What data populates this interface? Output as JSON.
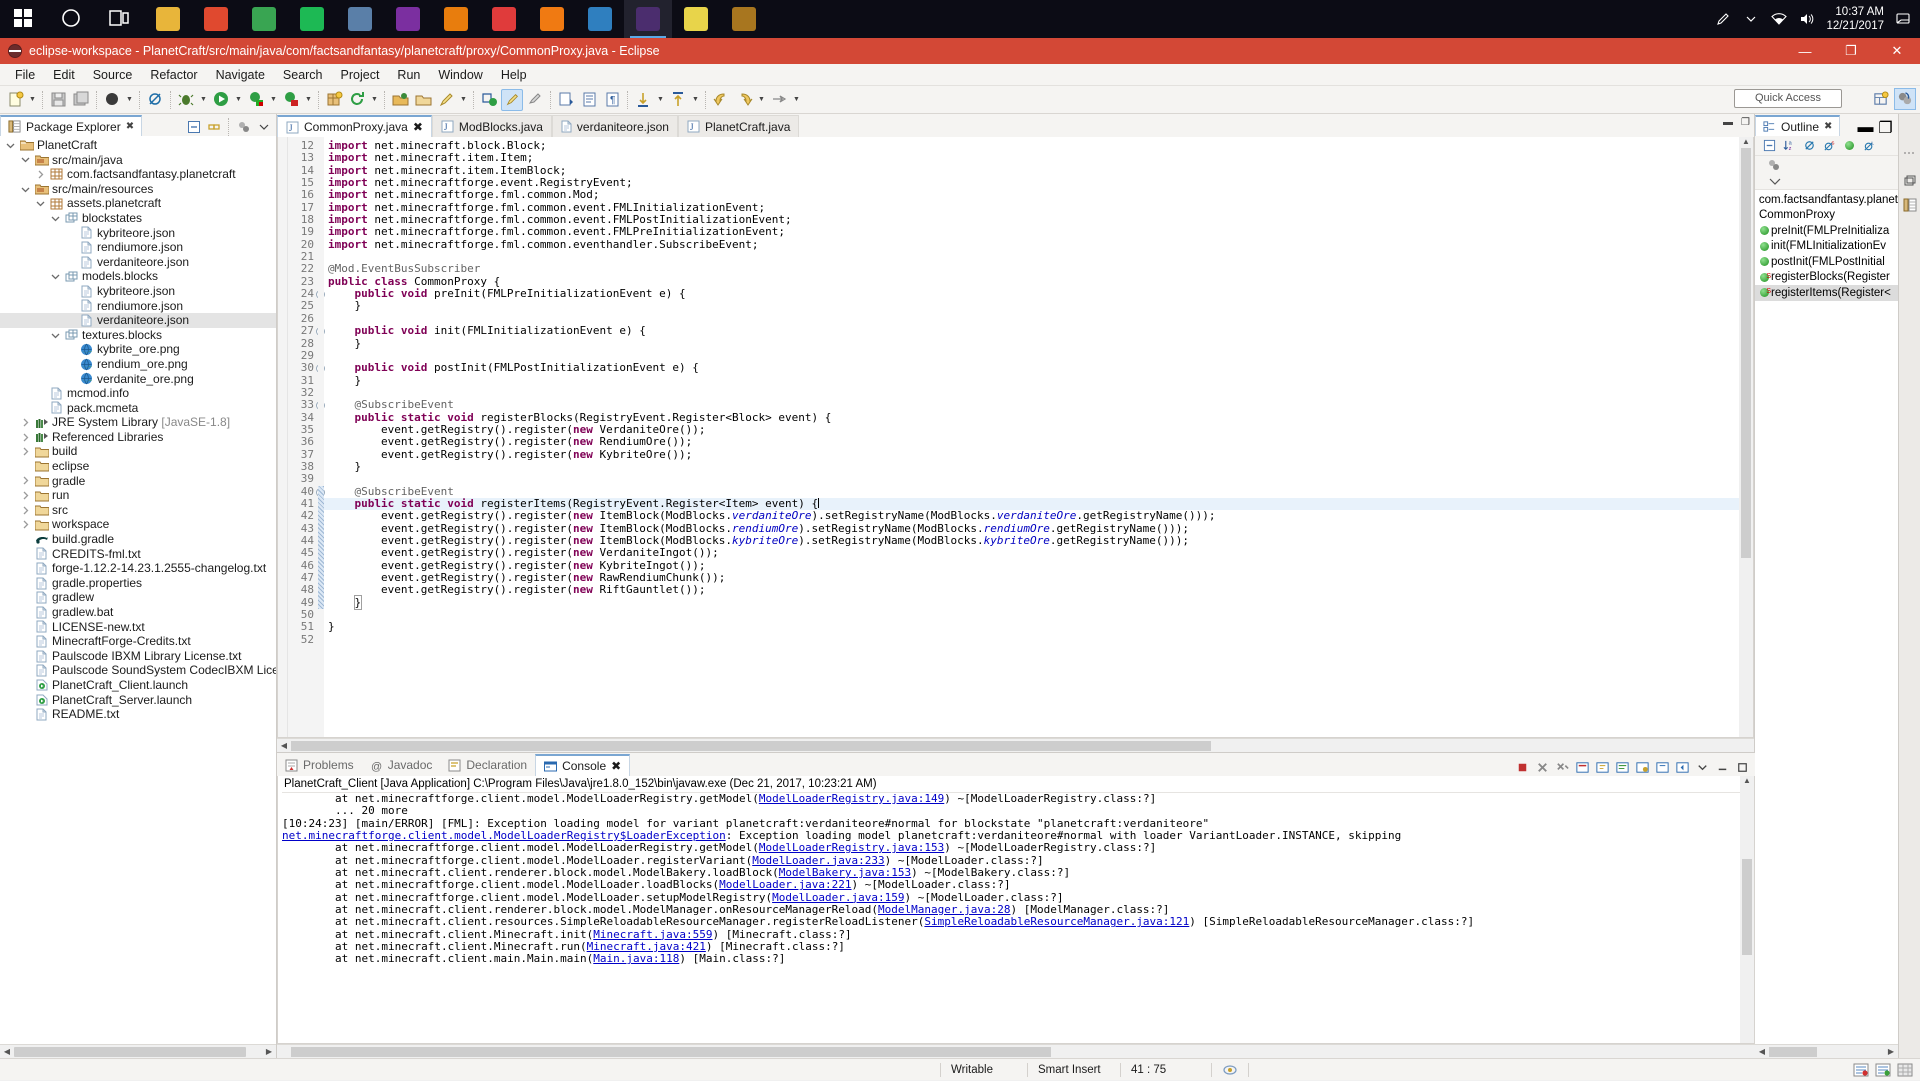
{
  "taskbar": {
    "apps": [
      {
        "name": "start-windows",
        "color": "#2a8fd6"
      },
      {
        "name": "cortana-search",
        "color": "#1b1b26"
      },
      {
        "name": "task-view",
        "color": "#1b1b26"
      },
      {
        "name": "video-editor",
        "color": "#e8b53a"
      },
      {
        "name": "paint-app",
        "color": "#e0492f"
      },
      {
        "name": "chrome-browser",
        "color": "#39a552"
      },
      {
        "name": "spotify",
        "color": "#1db954"
      },
      {
        "name": "calculator",
        "color": "#5a7fa8"
      },
      {
        "name": "onenote",
        "color": "#7b2fa0"
      },
      {
        "name": "blender",
        "color": "#e87d0d"
      },
      {
        "name": "recording-app",
        "color": "#e03b3b"
      },
      {
        "name": "vlc-player",
        "color": "#f07a12"
      },
      {
        "name": "globe-browser",
        "color": "#2f7fbf"
      },
      {
        "name": "eclipse-ide",
        "color": "#4b2d6e"
      },
      {
        "name": "notepad",
        "color": "#e8d44a"
      },
      {
        "name": "package-app",
        "color": "#a8761f"
      }
    ],
    "active_index": 13,
    "tray": {
      "pen_icon": "pen-icon",
      "chevron_icon": "show-hidden-icons-icon",
      "network_icon": "network-icon",
      "volume_icon": "volume-icon",
      "time": "10:37 AM",
      "date": "12/21/2017",
      "notifications_icon": "notifications-icon"
    }
  },
  "window": {
    "title": "eclipse-workspace - PlanetCraft/src/main/java/com/factsandfantasy/planetcraft/proxy/CommonProxy.java - Eclipse",
    "minimize": "—",
    "maximize": "❐",
    "close": "✕"
  },
  "menubar": {
    "items": [
      "File",
      "Edit",
      "Source",
      "Refactor",
      "Navigate",
      "Search",
      "Project",
      "Run",
      "Window",
      "Help"
    ]
  },
  "toolbar": {
    "quick_access_placeholder": "Quick Access",
    "buttons": [
      "new-wizard",
      "save",
      "save-all",
      "debug-skip-breakpoints",
      "toggle-breakpoint",
      "debug",
      "run",
      "run-external-tools",
      "coverage",
      "new-java-package",
      "refresh",
      "open-type",
      "open-task",
      "search",
      "next-annotation",
      "previous-annotation",
      "last-edit-location",
      "back",
      "forward",
      "pin-editor"
    ]
  },
  "explorer": {
    "tab_label": "Package Explorer",
    "toolbar_icons": [
      "collapse-all-icon",
      "link-with-editor-icon",
      "view-menu-icon",
      "view-chevron-icon"
    ],
    "tree": [
      {
        "depth": 0,
        "twist": "down",
        "icon": "project",
        "label": "PlanetCraft"
      },
      {
        "depth": 1,
        "twist": "down",
        "icon": "source-folder",
        "label": "src/main/java"
      },
      {
        "depth": 2,
        "twist": "right",
        "icon": "package",
        "label": "com.factsandfantasy.planetcraft"
      },
      {
        "depth": 1,
        "twist": "down",
        "icon": "source-folder",
        "label": "src/main/resources"
      },
      {
        "depth": 2,
        "twist": "down",
        "icon": "package",
        "label": "assets.planetcraft"
      },
      {
        "depth": 3,
        "twist": "down",
        "icon": "subpackage",
        "label": "blockstates"
      },
      {
        "depth": 4,
        "twist": "none",
        "icon": "file",
        "label": "kybriteore.json"
      },
      {
        "depth": 4,
        "twist": "none",
        "icon": "file",
        "label": "rendiumore.json"
      },
      {
        "depth": 4,
        "twist": "none",
        "icon": "file",
        "label": "verdaniteore.json"
      },
      {
        "depth": 3,
        "twist": "down",
        "icon": "subpackage",
        "label": "models.blocks"
      },
      {
        "depth": 4,
        "twist": "none",
        "icon": "file",
        "label": "kybriteore.json"
      },
      {
        "depth": 4,
        "twist": "none",
        "icon": "file",
        "label": "rendiumore.json"
      },
      {
        "depth": 4,
        "twist": "none",
        "icon": "file",
        "label": "verdaniteore.json",
        "selected": true
      },
      {
        "depth": 3,
        "twist": "down",
        "icon": "subpackage",
        "label": "textures.blocks"
      },
      {
        "depth": 4,
        "twist": "none",
        "icon": "image",
        "label": "kybrite_ore.png"
      },
      {
        "depth": 4,
        "twist": "none",
        "icon": "image",
        "label": "rendium_ore.png"
      },
      {
        "depth": 4,
        "twist": "none",
        "icon": "image",
        "label": "verdanite_ore.png"
      },
      {
        "depth": 2,
        "twist": "none",
        "icon": "file",
        "label": "mcmod.info"
      },
      {
        "depth": 2,
        "twist": "none",
        "icon": "file",
        "label": "pack.mcmeta"
      },
      {
        "depth": 1,
        "twist": "right",
        "icon": "library",
        "label": "JRE System Library ",
        "dim": "[JavaSE-1.8]"
      },
      {
        "depth": 1,
        "twist": "right",
        "icon": "library",
        "label": "Referenced Libraries"
      },
      {
        "depth": 1,
        "twist": "right",
        "icon": "folder",
        "label": "build"
      },
      {
        "depth": 1,
        "twist": "none",
        "icon": "folder",
        "label": "eclipse"
      },
      {
        "depth": 1,
        "twist": "right",
        "icon": "folder",
        "label": "gradle"
      },
      {
        "depth": 1,
        "twist": "right",
        "icon": "folder",
        "label": "run"
      },
      {
        "depth": 1,
        "twist": "right",
        "icon": "folder",
        "label": "src"
      },
      {
        "depth": 1,
        "twist": "right",
        "icon": "folder",
        "label": "workspace"
      },
      {
        "depth": 1,
        "twist": "none",
        "icon": "gradle",
        "label": "build.gradle"
      },
      {
        "depth": 1,
        "twist": "none",
        "icon": "file",
        "label": "CREDITS-fml.txt"
      },
      {
        "depth": 1,
        "twist": "none",
        "icon": "file",
        "label": "forge-1.12.2-14.23.1.2555-changelog.txt"
      },
      {
        "depth": 1,
        "twist": "none",
        "icon": "file",
        "label": "gradle.properties"
      },
      {
        "depth": 1,
        "twist": "none",
        "icon": "file",
        "label": "gradlew"
      },
      {
        "depth": 1,
        "twist": "none",
        "icon": "file",
        "label": "gradlew.bat"
      },
      {
        "depth": 1,
        "twist": "none",
        "icon": "file",
        "label": "LICENSE-new.txt"
      },
      {
        "depth": 1,
        "twist": "none",
        "icon": "file",
        "label": "MinecraftForge-Credits.txt"
      },
      {
        "depth": 1,
        "twist": "none",
        "icon": "file",
        "label": "Paulscode IBXM Library License.txt"
      },
      {
        "depth": 1,
        "twist": "none",
        "icon": "file",
        "label": "Paulscode SoundSystem CodecIBXM License.txt"
      },
      {
        "depth": 1,
        "twist": "none",
        "icon": "launch",
        "label": "PlanetCraft_Client.launch"
      },
      {
        "depth": 1,
        "twist": "none",
        "icon": "launch",
        "label": "PlanetCraft_Server.launch"
      },
      {
        "depth": 1,
        "twist": "none",
        "icon": "file",
        "label": "README.txt"
      }
    ]
  },
  "editor": {
    "tabs": [
      {
        "label": "CommonProxy.java",
        "icon": "java-file-icon",
        "active": true,
        "closable": true
      },
      {
        "label": "ModBlocks.java",
        "icon": "java-file-icon",
        "active": false,
        "closable": false
      },
      {
        "label": "verdaniteore.json",
        "icon": "json-file-icon",
        "active": false,
        "closable": false
      },
      {
        "label": "PlanetCraft.java",
        "icon": "java-file-icon",
        "active": false,
        "closable": false
      }
    ],
    "minimize_label": "—",
    "maximize_label": "❐",
    "first_line_number": 12,
    "lines": [
      {
        "n": 12,
        "fold": false,
        "html": "<span class=\"kw\">import</span> net.minecraft.block.Block;"
      },
      {
        "n": 13,
        "fold": false,
        "html": "<span class=\"kw\">import</span> net.minecraft.item.Item;"
      },
      {
        "n": 14,
        "fold": false,
        "html": "<span class=\"kw\">import</span> net.minecraft.item.ItemBlock;"
      },
      {
        "n": 15,
        "fold": false,
        "html": "<span class=\"kw\">import</span> net.minecraftforge.event.RegistryEvent;"
      },
      {
        "n": 16,
        "fold": false,
        "html": "<span class=\"kw\">import</span> net.minecraftforge.fml.common.Mod;"
      },
      {
        "n": 17,
        "fold": false,
        "html": "<span class=\"kw\">import</span> net.minecraftforge.fml.common.event.FMLInitializationEvent;"
      },
      {
        "n": 18,
        "fold": false,
        "html": "<span class=\"kw\">import</span> net.minecraftforge.fml.common.event.FMLPostInitializationEvent;"
      },
      {
        "n": 19,
        "fold": false,
        "html": "<span class=\"kw\">import</span> net.minecraftforge.fml.common.event.FMLPreInitializationEvent;"
      },
      {
        "n": 20,
        "fold": false,
        "html": "<span class=\"kw\">import</span> net.minecraftforge.fml.common.eventhandler.SubscribeEvent;"
      },
      {
        "n": 21,
        "fold": false,
        "html": ""
      },
      {
        "n": 22,
        "fold": false,
        "html": "<span class=\"ann\">@Mod.EventBusSubscriber</span>"
      },
      {
        "n": 23,
        "fold": false,
        "html": "<span class=\"kw\">public class</span> CommonProxy {"
      },
      {
        "n": 24,
        "fold": true,
        "html": "    <span class=\"kw\">public void</span> preInit(FMLPreInitializationEvent e) {"
      },
      {
        "n": 25,
        "fold": false,
        "html": "    }"
      },
      {
        "n": 26,
        "fold": false,
        "html": ""
      },
      {
        "n": 27,
        "fold": true,
        "html": "    <span class=\"kw\">public void</span> init(FMLInitializationEvent e) {"
      },
      {
        "n": 28,
        "fold": false,
        "html": "    }"
      },
      {
        "n": 29,
        "fold": false,
        "html": ""
      },
      {
        "n": 30,
        "fold": true,
        "html": "    <span class=\"kw\">public void</span> postInit(FMLPostInitializationEvent e) {"
      },
      {
        "n": 31,
        "fold": false,
        "html": "    }"
      },
      {
        "n": 32,
        "fold": false,
        "html": ""
      },
      {
        "n": 33,
        "fold": true,
        "html": "    <span class=\"ann\">@SubscribeEvent</span>"
      },
      {
        "n": 34,
        "fold": false,
        "html": "    <span class=\"kw\">public static void</span> registerBlocks(RegistryEvent.Register&lt;Block&gt; event) {"
      },
      {
        "n": 35,
        "fold": false,
        "html": "        event.getRegistry().register(<span class=\"kw\">new</span> VerdaniteOre());"
      },
      {
        "n": 36,
        "fold": false,
        "html": "        event.getRegistry().register(<span class=\"kw\">new</span> RendiumOre());"
      },
      {
        "n": 37,
        "fold": false,
        "html": "        event.getRegistry().register(<span class=\"kw\">new</span> KybriteOre());"
      },
      {
        "n": 38,
        "fold": false,
        "html": "    }"
      },
      {
        "n": 39,
        "fold": false,
        "html": ""
      },
      {
        "n": 40,
        "fold": true,
        "html": "    <span class=\"ann\">@SubscribeEvent</span>",
        "changed": true
      },
      {
        "n": 41,
        "fold": false,
        "html": "    <span class=\"kw\">public static void</span> registerItems(RegistryEvent.Register&lt;Item&gt; event) {<span class=\"caret\"></span>",
        "highlight": true,
        "changed": true
      },
      {
        "n": 42,
        "fold": false,
        "html": "        event.getRegistry().register(<span class=\"kw\">new</span> ItemBlock(ModBlocks.<span class=\"fld\">verdaniteOre</span>).setRegistryName(ModBlocks.<span class=\"fld\">verdaniteOre</span>.getRegistryName()));",
        "changed": true
      },
      {
        "n": 43,
        "fold": false,
        "html": "        event.getRegistry().register(<span class=\"kw\">new</span> ItemBlock(ModBlocks.<span class=\"fld\">rendiumOre</span>).setRegistryName(ModBlocks.<span class=\"fld\">rendiumOre</span>.getRegistryName()));",
        "changed": true
      },
      {
        "n": 44,
        "fold": false,
        "html": "        event.getRegistry().register(<span class=\"kw\">new</span> ItemBlock(ModBlocks.<span class=\"fld\">kybriteOre</span>).setRegistryName(ModBlocks.<span class=\"fld\">kybriteOre</span>.getRegistryName()));",
        "changed": true
      },
      {
        "n": 45,
        "fold": false,
        "html": "        event.getRegistry().register(<span class=\"kw\">new</span> VerdaniteIngot());",
        "changed": true
      },
      {
        "n": 46,
        "fold": false,
        "html": "        event.getRegistry().register(<span class=\"kw\">new</span> KybriteIngot());",
        "changed": true
      },
      {
        "n": 47,
        "fold": false,
        "html": "        event.getRegistry().register(<span class=\"kw\">new</span> RawRendiumChunk());",
        "changed": true
      },
      {
        "n": 48,
        "fold": false,
        "html": "        event.getRegistry().register(<span class=\"kw\">new</span> RiftGauntlet());",
        "changed": true
      },
      {
        "n": 49,
        "fold": false,
        "html": "    <span class=\"brkt\">}</span>",
        "changed": true
      },
      {
        "n": 50,
        "fold": false,
        "html": ""
      },
      {
        "n": 51,
        "fold": false,
        "html": "}"
      },
      {
        "n": 52,
        "fold": false,
        "html": ""
      }
    ]
  },
  "console": {
    "tabs": [
      {
        "label": "Problems",
        "icon": "problems-icon",
        "active": false
      },
      {
        "label": "Javadoc",
        "icon": "javadoc-icon",
        "active": false
      },
      {
        "label": "Declaration",
        "icon": "declaration-icon",
        "active": false
      },
      {
        "label": "Console",
        "icon": "console-icon",
        "active": true,
        "closable": true
      }
    ],
    "toolbar_icons": [
      "terminate-icon",
      "remove-launch-icon",
      "remove-all-terminated-icon",
      "clear-console-icon",
      "scroll-lock-icon",
      "word-wrap-icon",
      "pin-console-icon",
      "display-selected-console-icon",
      "open-console-icon",
      "view-menu-icon",
      "minimize-icon",
      "maximize-icon"
    ],
    "launch_header": "PlanetCraft_Client [Java Application] C:\\Program Files\\Java\\jre1.8.0_152\\bin\\javaw.exe (Dec 21, 2017, 10:23:21 AM)",
    "lines": [
      {
        "html": "        at net.minecraftforge.client.model.ModelLoaderRegistry.getModel(<span class=\"lnk\">ModelLoaderRegistry.java:149</span>) ~[ModelLoaderRegistry.class:?]"
      },
      {
        "html": "        ... 20 more"
      },
      {
        "html": "[10:24:23] [main/ERROR] [FML]: Exception loading model for variant planetcraft:verdaniteore#normal for blockstate \"planetcraft:verdaniteore\""
      },
      {
        "html": "<span class=\"lnk\">net.minecraftforge.client.model.ModelLoaderRegistry$LoaderException</span>: Exception loading model planetcraft:verdaniteore#normal with loader VariantLoader.INSTANCE, skipping"
      },
      {
        "html": "        at net.minecraftforge.client.model.ModelLoaderRegistry.getModel(<span class=\"lnk\">ModelLoaderRegistry.java:153</span>) ~[ModelLoaderRegistry.class:?]"
      },
      {
        "html": "        at net.minecraftforge.client.model.ModelLoader.registerVariant(<span class=\"lnk\">ModelLoader.java:233</span>) ~[ModelLoader.class:?]"
      },
      {
        "html": "        at net.minecraft.client.renderer.block.model.ModelBakery.loadBlock(<span class=\"lnk\">ModelBakery.java:153</span>) ~[ModelBakery.class:?]"
      },
      {
        "html": "        at net.minecraftforge.client.model.ModelLoader.loadBlocks(<span class=\"lnk\">ModelLoader.java:221</span>) ~[ModelLoader.class:?]"
      },
      {
        "html": "        at net.minecraftforge.client.model.ModelLoader.setupModelRegistry(<span class=\"lnk\">ModelLoader.java:159</span>) ~[ModelLoader.class:?]"
      },
      {
        "html": "        at net.minecraft.client.renderer.block.model.ModelManager.onResourceManagerReload(<span class=\"lnk\">ModelManager.java:28</span>) [ModelManager.class:?]"
      },
      {
        "html": "        at net.minecraft.client.resources.SimpleReloadableResourceManager.registerReloadListener(<span class=\"lnk\">SimpleReloadableResourceManager.java:121</span>) [SimpleReloadableResourceManager.class:?]"
      },
      {
        "html": "        at net.minecraft.client.Minecraft.init(<span class=\"lnk\">Minecraft.java:559</span>) [Minecraft.class:?]"
      },
      {
        "html": "        at net.minecraft.client.Minecraft.run(<span class=\"lnk\">Minecraft.java:421</span>) [Minecraft.class:?]"
      },
      {
        "html": "        at net.minecraft.client.main.Main.main(<span class=\"lnk\">Main.java:118</span>) [Main.class:?]"
      }
    ]
  },
  "outline": {
    "tab_label": "Outline",
    "toolbar_icons": [
      "collapse-all-icon",
      "sort-icon",
      "hide-fields-icon",
      "hide-static-icon",
      "hide-non-public-icon",
      "hide-local-types-icon"
    ],
    "items": [
      {
        "icon": "package-icon",
        "label": "com.factsandfantasy.planet",
        "level": 0
      },
      {
        "icon": "class-icon",
        "label": "CommonProxy",
        "level": 0
      },
      {
        "icon": "method-public-icon",
        "label": "preInit(FMLPreInitializa",
        "level": 1
      },
      {
        "icon": "method-public-icon",
        "label": "init(FMLInitializationEv",
        "level": 1
      },
      {
        "icon": "method-public-icon",
        "label": "postInit(FMLPostInitial",
        "level": 1
      },
      {
        "icon": "method-public-static-icon",
        "label": "registerBlocks(Register",
        "level": 1,
        "static": true
      },
      {
        "icon": "method-public-static-icon",
        "label": "registerItems(Register<",
        "level": 1,
        "static": true,
        "selected": true
      }
    ]
  },
  "fast_view": {
    "icons": [
      "restore-icon",
      "package-explorer-icon"
    ]
  },
  "statusbar": {
    "writable": "Writable",
    "insert_mode": "Smart Insert",
    "cursor_position": "41 : 75",
    "right_icons": [
      "launch-progress-icon",
      "heap-status-icon",
      "error-log-icon",
      "sync-icon",
      "grid-icon"
    ]
  }
}
